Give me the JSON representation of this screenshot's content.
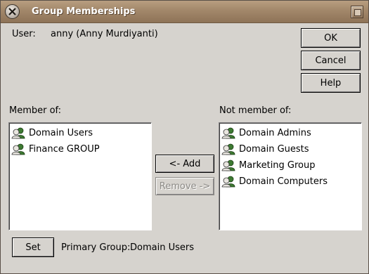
{
  "window": {
    "title": "Group Memberships"
  },
  "user": {
    "label": "User:",
    "value": "anny (Anny Murdiyanti)"
  },
  "buttons": {
    "ok": "OK",
    "cancel": "Cancel",
    "help": "Help",
    "add": "<- Add",
    "remove": "Remove ->",
    "set": "Set"
  },
  "member_of": {
    "label": "Member of:",
    "items": [
      "Domain Users",
      "Finance GROUP"
    ]
  },
  "not_member_of": {
    "label": "Not member of:",
    "items": [
      "Domain Admins",
      "Domain Guests",
      "Marketing Group",
      "Domain Computers"
    ]
  },
  "primary_group": {
    "label": "Primary Group:",
    "value": "Domain Users"
  },
  "icons": {
    "group": "group-icon",
    "window_menu": "window-menu-icon",
    "close": "close-icon"
  },
  "colors": {
    "titlebar": "#a2876a",
    "dialog_bg": "#d6d3ce"
  }
}
